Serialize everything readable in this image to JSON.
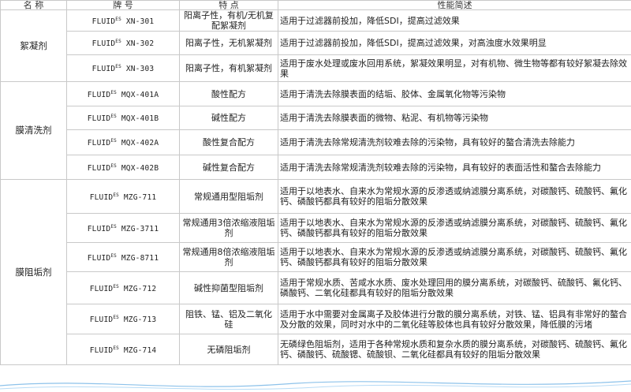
{
  "header": {
    "name": "名 称",
    "code": "牌 号",
    "feature": "特 点",
    "desc": "性能简述"
  },
  "groups": [
    {
      "name": "絮凝剂",
      "rows": [
        {
          "brand": "FLUID",
          "sup": "ES",
          "model": "XN-301",
          "feature": "阳离子性，有机/无机复配絮凝剂",
          "desc": "适用于过滤器前投加，降低SDI，提高过滤效果"
        },
        {
          "brand": "FLUID",
          "sup": "ES",
          "model": "XN-302",
          "feature": "阳离子性，无机絮凝剂",
          "desc": "适用于过滤器前投加，降低SDI，提高过滤效果，对高浊度水效果明显"
        },
        {
          "brand": "FLUID",
          "sup": "ES",
          "model": "XN-303",
          "feature": "阳离子性，有机絮凝剂",
          "desc": "适用于废水处理或废水回用系统，絮凝效果明显，对有机物、微生物等都有较好絮凝去除效果"
        }
      ]
    },
    {
      "name": "膜清洗剂",
      "rows": [
        {
          "brand": "FLUID",
          "sup": "ES",
          "model": "MQX-401A",
          "feature": "酸性配方",
          "desc": "适用于清洗去除膜表面的结垢、胶体、金属氧化物等污染物"
        },
        {
          "brand": "FLUID",
          "sup": "ES",
          "model": "MQX-401B",
          "feature": "碱性配方",
          "desc": "适用于清洗去除膜表面的微物、粘泥、有机物等污染物"
        },
        {
          "brand": "FLUID",
          "sup": "ES",
          "model": "MQX-402A",
          "feature": "酸性复合配方",
          "desc": "适用于清洗去除常规清洗剂较难去除的污染物，具有较好的螯合清洗去除能力"
        },
        {
          "brand": "FLUID",
          "sup": "ES",
          "model": "MQX-402B",
          "feature": "碱性复合配方",
          "desc": "适用于清洗去除常规清洗剂较难去除的污染物，具有较好的表面活性和螯合去除能力"
        }
      ]
    },
    {
      "name": "膜阻垢剂",
      "rows": [
        {
          "brand": "FLUID",
          "sup": "ES",
          "model": "MZG-711",
          "feature": "常规通用型阻垢剂",
          "desc": "适用于以地表水、自来水为常规水源的反渗透或纳滤膜分离系统，对碳酸钙、硫酸钙、氟化钙、磷酸钙都具有较好的阻垢分散效果"
        },
        {
          "brand": "FLUID",
          "sup": "ES",
          "model": "MZG-3711",
          "feature": "常规通用3倍浓缩液阻垢剂",
          "desc": "适用于以地表水、自来水为常规水源的反渗透或纳滤膜分离系统，对碳酸钙、硫酸钙、氟化钙、磷酸钙都具有较好的阻垢分散效果"
        },
        {
          "brand": "FLUID",
          "sup": "ES",
          "model": "MZG-8711",
          "feature": "常规通用8倍浓缩液阻垢剂",
          "desc": "适用于以地表水、自来水为常规水源的反渗透或纳滤膜分离系统，对碳酸钙、硫酸钙、氟化钙、磷酸钙都具有较好的阻垢分散效果"
        },
        {
          "brand": "FLUID",
          "sup": "ES",
          "model": "MZG-712",
          "feature": "碱性抑菌型阻垢剂",
          "desc": "适用于常规水质、苦咸水水质、废水处理回用的膜分离系统，对碳酸钙、硫酸钙、氟化钙、磷酸钙、二氧化硅都具有较好的阻垢分散效果"
        },
        {
          "brand": "FLUID",
          "sup": "ES",
          "model": "MZG-713",
          "feature": "阻铁、锰、铝及二氧化硅",
          "desc": "适用于水中需要对金属离子及胶体进行分散的膜分离系统，对铁、锰、铝具有非常好的螯合及分散的效果，同时对水中的二氧化硅等胶体也具有较好分散效果，降低膜的污堵"
        },
        {
          "brand": "FLUID",
          "sup": "ES",
          "model": "MZG-714",
          "feature": "无磷阻垢剂",
          "desc": "无磷绿色阻垢剂，适用于各种常规水质和复杂水质的膜分离系统，对碳酸钙、硫酸钙、氟化钙、磷酸钙、硫酸锶、硫酸钡、二氧化硅都具有较好的阻垢分散效果"
        }
      ]
    }
  ],
  "colors": {
    "border": "#c9c9c9",
    "wave": "#2f8fd8",
    "text": "#222222"
  }
}
